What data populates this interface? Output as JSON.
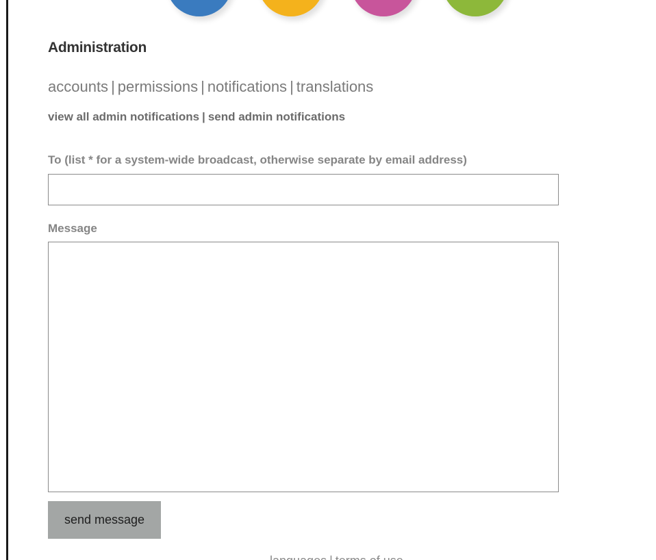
{
  "header": {
    "decor_colors": [
      "#3a7bbf",
      "#f4b21c",
      "#c8559b",
      "#8db83a"
    ]
  },
  "admin": {
    "title": "Administration",
    "main_nav": [
      "accounts",
      "permissions",
      "notifications",
      "translations"
    ],
    "separator": "|",
    "sub_nav": [
      "view all admin notifications",
      "send admin notifications"
    ]
  },
  "form": {
    "to_label": "To (list * for a system-wide broadcast, otherwise separate by email address)",
    "to_value": "",
    "message_label": "Message",
    "message_value": "",
    "send_label": "send message"
  },
  "footer": {
    "links": [
      "languages",
      "terms of use"
    ]
  }
}
